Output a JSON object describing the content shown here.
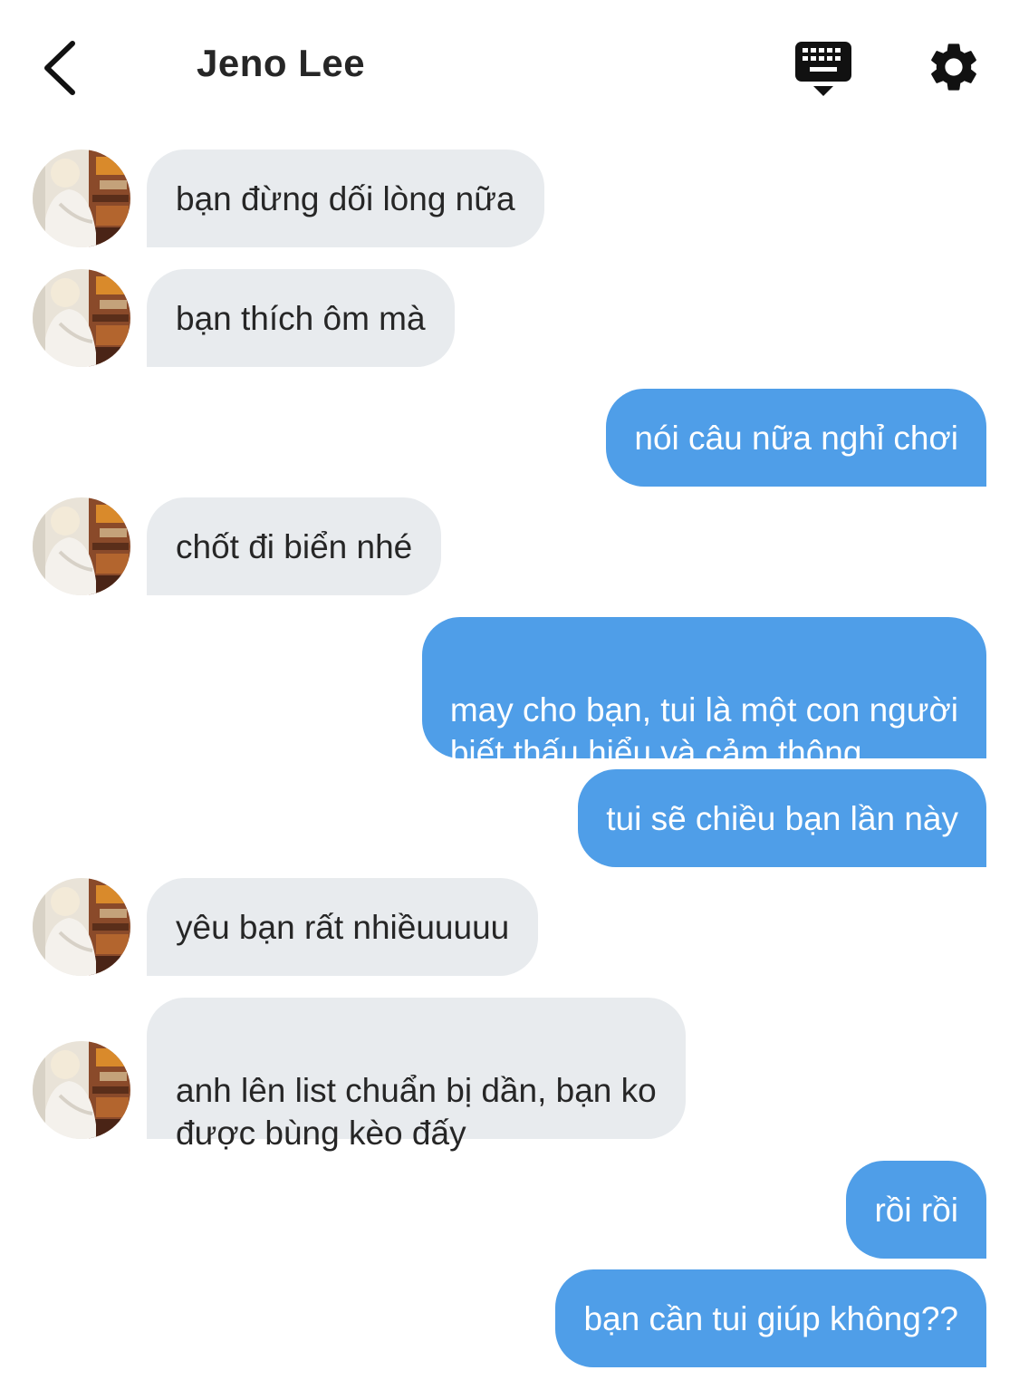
{
  "header": {
    "contact_name": "Jeno Lee"
  },
  "icons": {
    "back": "chevron-left-icon",
    "keyboard": "keyboard-icon",
    "settings": "gear-icon"
  },
  "colors": {
    "incoming_bubble": "#e8ebee",
    "outgoing_bubble": "#4f9ee8",
    "text_dark": "#262626"
  },
  "messages": [
    {
      "direction": "incoming",
      "text": "bạn đừng dối lòng nữa"
    },
    {
      "direction": "incoming",
      "text": "bạn thích ôm mà"
    },
    {
      "direction": "outgoing",
      "text": "nói câu nữa nghỉ chơi"
    },
    {
      "direction": "incoming",
      "text": "chốt đi biển nhé"
    },
    {
      "direction": "outgoing",
      "text": "may cho bạn, tui là một con người\nbiết thấu hiểu và cảm thông"
    },
    {
      "direction": "outgoing",
      "text": "tui sẽ chiều bạn lần này"
    },
    {
      "direction": "incoming",
      "text": "yêu bạn rất nhiềuuuuu"
    },
    {
      "direction": "incoming",
      "text": "anh lên list chuẩn bị dần, bạn ko\nđược bùng kèo đấy"
    },
    {
      "direction": "outgoing",
      "text": "rồi rồi"
    },
    {
      "direction": "outgoing",
      "text": "bạn cần tui giúp không??"
    }
  ]
}
